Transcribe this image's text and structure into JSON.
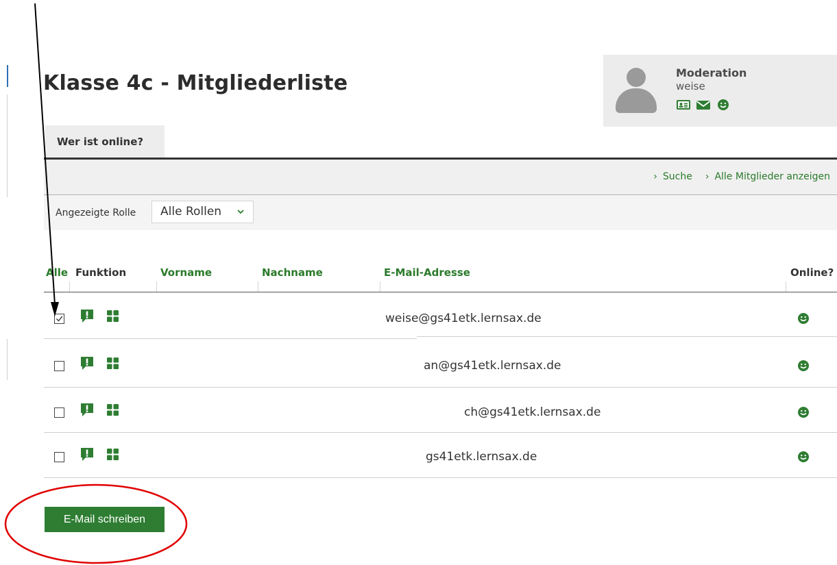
{
  "page": {
    "title": "Klasse 4c - Mitgliederliste"
  },
  "user_card": {
    "role": "Moderation",
    "username": "weise",
    "icons": [
      "contact-card-icon",
      "envelope-icon",
      "smiley-icon"
    ]
  },
  "tabs": [
    {
      "label": "Wer ist online?",
      "active": true
    }
  ],
  "toolbar": {
    "links": [
      {
        "label": "Suche"
      },
      {
        "label": "Alle Mitglieder anzeigen"
      }
    ]
  },
  "filter": {
    "label": "Angezeigte Rolle",
    "selected": "Alle Rollen"
  },
  "table": {
    "columns": {
      "all": "Alle",
      "function": "Funktion",
      "firstname": "Vorname",
      "lastname": "Nachname",
      "email": "E-Mail-Adresse",
      "online": "Online?"
    },
    "rows": [
      {
        "checked": true,
        "email": "weise@gs41etk.lernsax.de",
        "online": true
      },
      {
        "checked": false,
        "email": "an@gs41etk.lernsax.de",
        "online": true
      },
      {
        "checked": false,
        "email": "ch@gs41etk.lernsax.de",
        "online": true
      },
      {
        "checked": false,
        "email": "gs41etk.lernsax.de",
        "online": true
      }
    ]
  },
  "actions": {
    "write_email": "E-Mail schreiben"
  },
  "colors": {
    "accent_green": "#2e7d32",
    "link_green": "#2b7a2b",
    "annotation_red": "#e00000",
    "annotation_arrow": "#000000"
  }
}
